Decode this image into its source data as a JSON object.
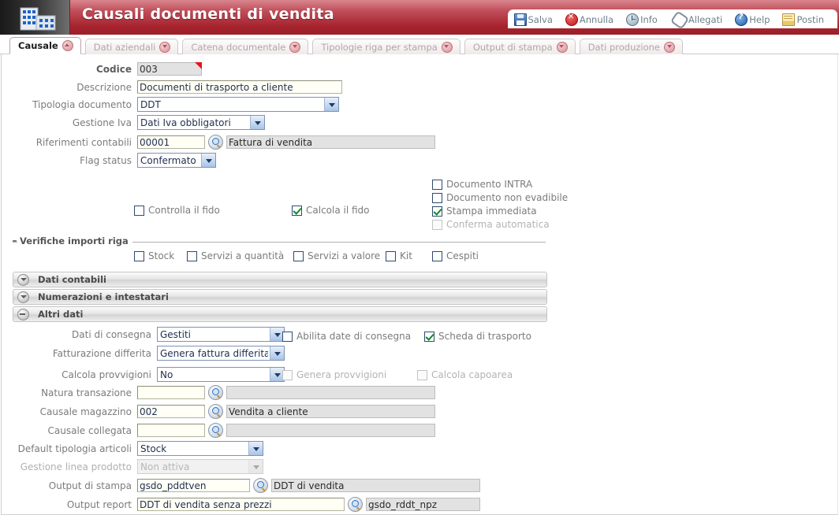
{
  "window": {
    "title": "Causali documenti di vendita",
    "logo_icon": "office-building-icon"
  },
  "toolbar": {
    "items": [
      {
        "label": "Salva",
        "icon": "floppy-disk-icon"
      },
      {
        "label": "Annulla",
        "icon": "red-cancel-icon"
      },
      {
        "label": "Info",
        "icon": "info-clock-icon"
      },
      {
        "label": "Allegati",
        "icon": "paperclip-icon"
      },
      {
        "label": "Help",
        "icon": "question-mark-icon"
      },
      {
        "label": "Postin",
        "icon": "post-it-icon"
      }
    ]
  },
  "tabs": [
    {
      "label": "Causale",
      "active": true
    },
    {
      "label": "Dati aziendali",
      "active": false
    },
    {
      "label": "Catena documentale",
      "active": false
    },
    {
      "label": "Tipologie riga per stampa",
      "active": false
    },
    {
      "label": "Output di stampa",
      "active": false
    },
    {
      "label": "Dati produzione",
      "active": false
    }
  ],
  "form": {
    "codice": {
      "label": "Codice",
      "value": "003"
    },
    "descrizione": {
      "label": "Descrizione",
      "value": "Documenti di trasporto a cliente"
    },
    "tipologia_documento": {
      "label": "Tipologia documento",
      "value": "DDT"
    },
    "gestione_iva": {
      "label": "Gestione Iva",
      "value": "Dati Iva obbligatori"
    },
    "riferimenti_contabili": {
      "label": "Riferimenti contabili",
      "code": "00001",
      "description": "Fattura di vendita",
      "lens_icon": "magnifier-icon"
    },
    "flag_status": {
      "label": "Flag status",
      "value": "Confermato"
    },
    "controlla_fido": {
      "label": "Controlla il fido",
      "checked": false,
      "disabled": false
    },
    "calcola_fido": {
      "label": "Calcola il fido",
      "checked": true,
      "disabled": false
    },
    "right_checks": [
      {
        "label": "Documento INTRA",
        "checked": false,
        "disabled": false
      },
      {
        "label": "Documento non evadibile",
        "checked": false,
        "disabled": false
      },
      {
        "label": "Stampa immediata",
        "checked": true,
        "disabled": false
      },
      {
        "label": "Conferma automatica",
        "checked": false,
        "disabled": true
      }
    ],
    "verifiche": {
      "legend": "Verifiche importi riga",
      "items": [
        {
          "label": "Stock",
          "checked": false
        },
        {
          "label": "Servizi a quantità",
          "checked": false
        },
        {
          "label": "Servizi a valore",
          "checked": false
        },
        {
          "label": "Kit",
          "checked": false
        },
        {
          "label": "Cespiti",
          "checked": false
        }
      ]
    }
  },
  "sections": [
    {
      "label": "Dati contabili",
      "state": "collapsed",
      "icon": "chevron-down-icon"
    },
    {
      "label": "Numerazioni e intestatari",
      "state": "collapsed",
      "icon": "chevron-down-icon"
    },
    {
      "label": "Altri dati",
      "state": "expanded",
      "icon": "minus-circle-icon"
    }
  ],
  "altri_dati": {
    "dati_consegna": {
      "label": "Dati di consegna",
      "value": "Gestiti"
    },
    "fatturazione_differita": {
      "label": "Fatturazione differita",
      "value": "Genera fattura differita"
    },
    "calcola_provvigioni": {
      "label": "Calcola provvigioni",
      "value": "No"
    },
    "abilita_date": {
      "label": "Abilita date di consegna",
      "checked": false,
      "disabled": false
    },
    "scheda_trasporto": {
      "label": "Scheda di trasporto",
      "checked": true,
      "disabled": false
    },
    "genera_provvigioni": {
      "label": "Genera provvigioni",
      "checked": false,
      "disabled": true
    },
    "calcola_capoarea": {
      "label": "Calcola capoarea",
      "checked": false,
      "disabled": true
    },
    "natura_transazione": {
      "label": "Natura transazione",
      "code": "",
      "description": ""
    },
    "causale_magazzino": {
      "label": "Causale magazzino",
      "code": "002",
      "description": "Vendita a cliente"
    },
    "causale_collegata": {
      "label": "Causale collegata",
      "code": "",
      "description": ""
    },
    "default_tipologia": {
      "label": "Default tipologia articoli",
      "value": "Stock"
    },
    "gestione_linea": {
      "label": "Gestione linea prodotto",
      "value": "Non attiva",
      "disabled": true
    },
    "output_stampa": {
      "label": "Output di stampa",
      "code": "gsdo_pddtven",
      "description": "DDT di vendita"
    },
    "output_report": {
      "label": "Output report",
      "code": "DDT di vendita senza prezzi",
      "description": "gsdo_rddt_npz"
    }
  },
  "colors": {
    "title_bar_red": "#a7242f",
    "accent_red": "#e8131a",
    "field_bg": "#fffff5",
    "readonly_bg": "#e2e2e2",
    "check_green": "#0a8a2a"
  }
}
